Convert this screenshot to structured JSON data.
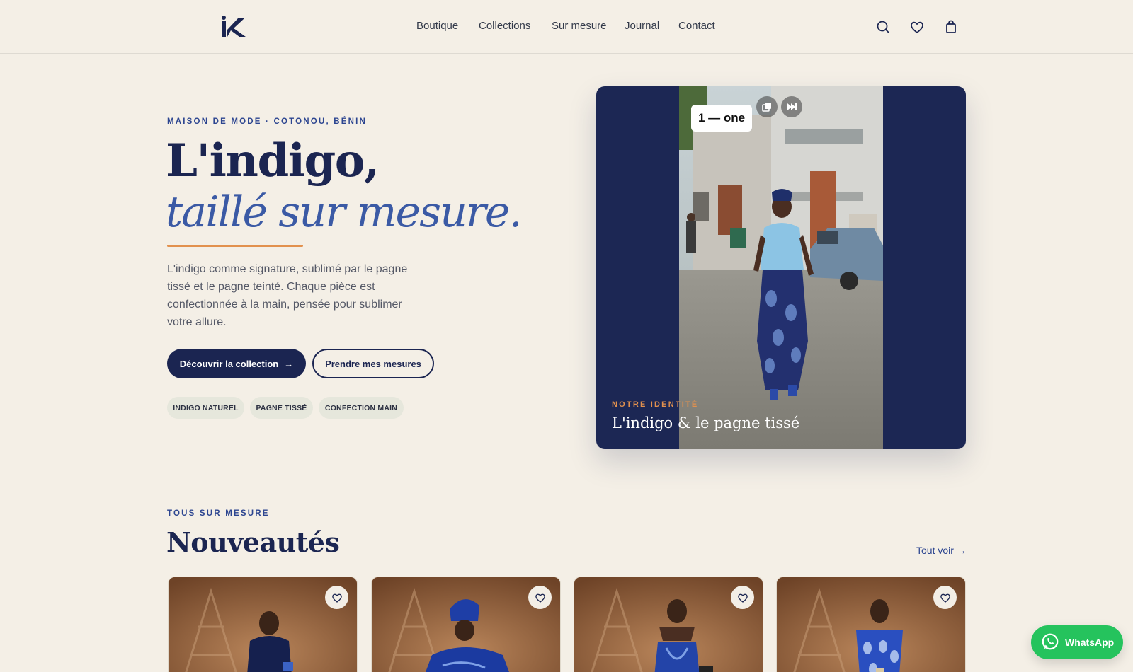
{
  "header": {
    "logo_text": "K",
    "nav": [
      "Boutique",
      "Collections",
      "Sur mesure",
      "Journal",
      "Contact"
    ],
    "icons": [
      "search-icon",
      "heart-icon",
      "bag-icon"
    ]
  },
  "hero": {
    "eyebrow": "MAISON DE MODE · COTONOU, BÉNIN",
    "title_line1": "L'indigo,",
    "title_line2": "taillé sur mesure.",
    "description": "L'indigo comme signature, sublimé par le pagne tissé et le pagne teinté. Chaque pièce est confectionnée à la main, pensée pour sublimer votre allure.",
    "cta_primary": "Découvrir la collection",
    "cta_primary_arrow": "→",
    "cta_secondary": "Prendre mes mesures",
    "tags": [
      "INDIGO NATUREL",
      "PAGNE TISSÉ",
      "CONFECTION MAIN"
    ]
  },
  "hero_card": {
    "reel_badge": "1 — one",
    "eyebrow": "NOTRE IDENTITÉ",
    "title": "L'indigo & le pagne tissé"
  },
  "section": {
    "eyebrow": "TOUS SUR MESURE",
    "title": "Nouveautés",
    "see_all": "Tout voir →"
  },
  "whatsapp": {
    "label": "WhatsApp"
  },
  "colors": {
    "background": "#f4efe6",
    "navy": "#1b2551",
    "indigo": "#3b5aa5",
    "accent": "#e2914e",
    "whatsapp": "#25c35d"
  }
}
